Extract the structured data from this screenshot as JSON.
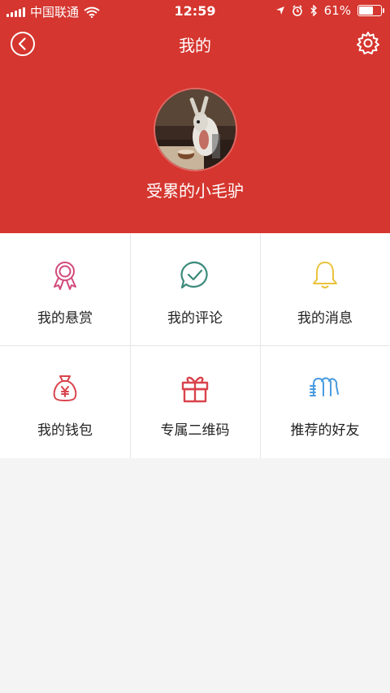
{
  "status_bar": {
    "carrier": "中国联通",
    "time": "12:59",
    "battery": "61%",
    "battery_level": 0.61
  },
  "nav": {
    "title": "我的",
    "back_icon": "back-arrow-icon",
    "settings_icon": "gear-icon"
  },
  "profile": {
    "username": "受累的小毛驴"
  },
  "menu": [
    {
      "label": "我的悬赏",
      "icon": "award-ribbon-icon",
      "color": "#d24a7b"
    },
    {
      "label": "我的评论",
      "icon": "check-comment-icon",
      "color": "#3b8a7a"
    },
    {
      "label": "我的消息",
      "icon": "bell-icon",
      "color": "#e9c23d"
    },
    {
      "label": "我的钱包",
      "icon": "money-bag-icon",
      "color": "#d9434b"
    },
    {
      "label": "专属二维码",
      "icon": "gift-icon",
      "color": "#d9434b"
    },
    {
      "label": "推荐的好友",
      "icon": "friends-icon",
      "color": "#4a9be0"
    }
  ],
  "colors": {
    "header": "#d5362f",
    "background": "#f4f4f4"
  }
}
